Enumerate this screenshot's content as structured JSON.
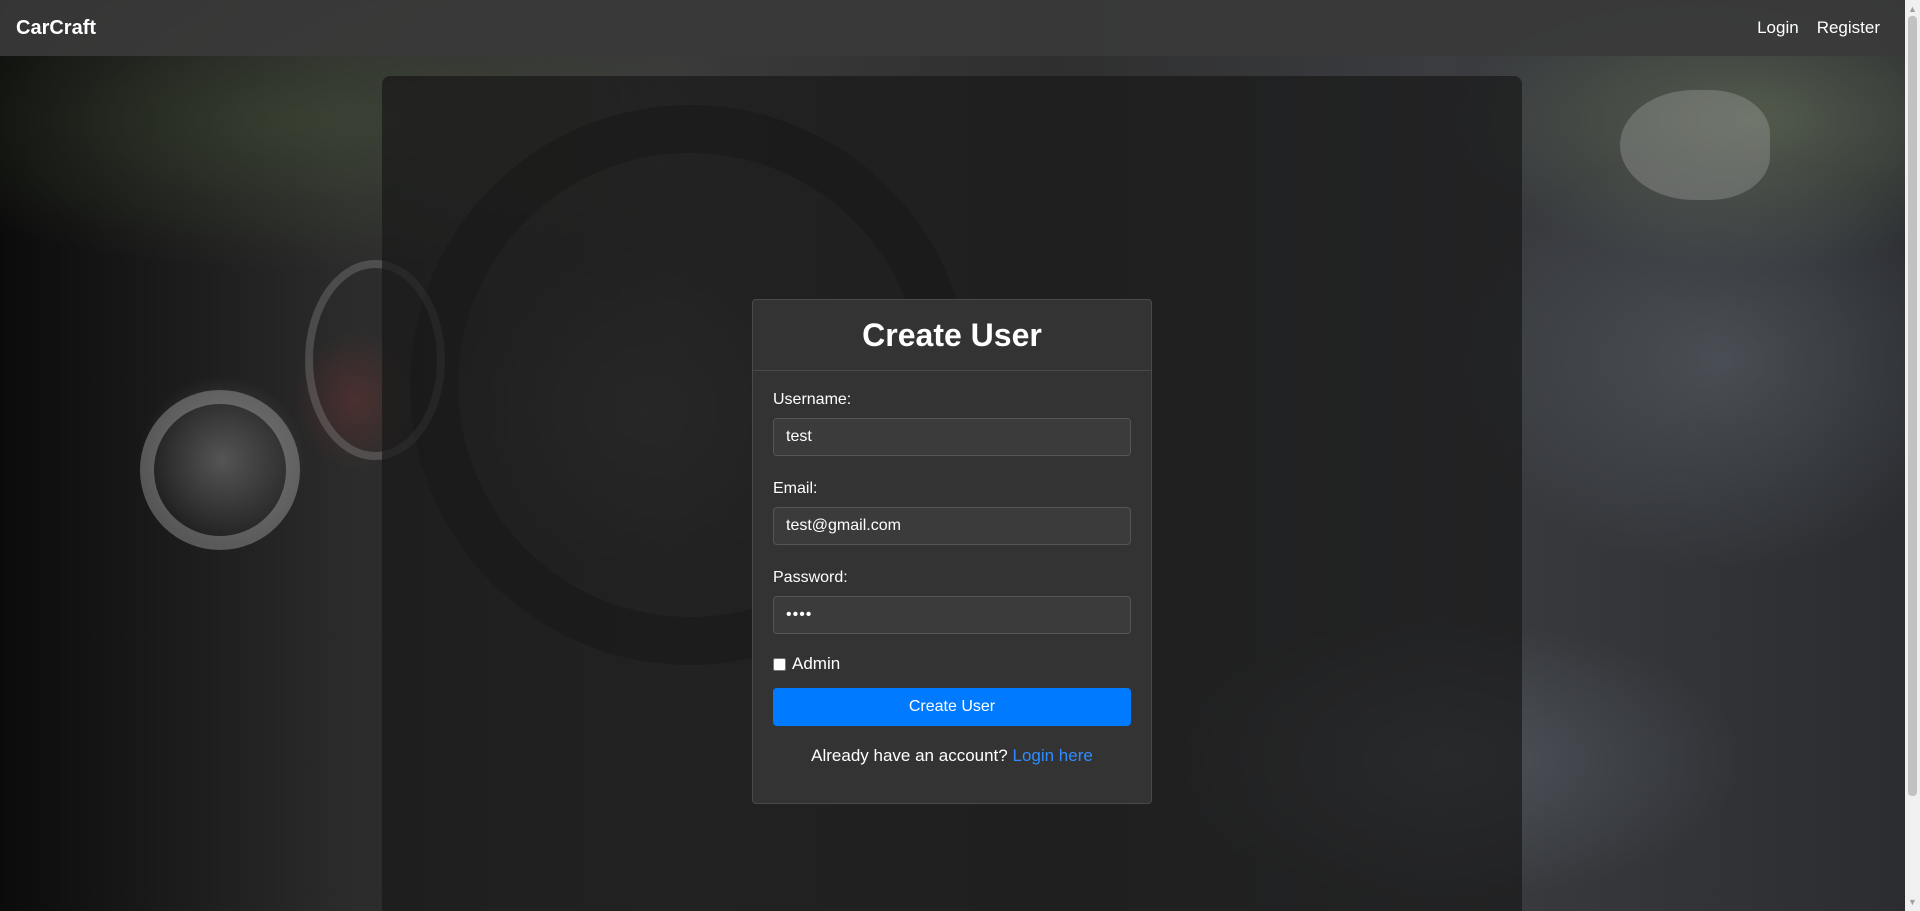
{
  "navbar": {
    "brand": "CarCraft",
    "links": [
      {
        "label": "Login"
      },
      {
        "label": "Register"
      }
    ]
  },
  "form": {
    "title": "Create User",
    "username": {
      "label": "Username:",
      "value": "test"
    },
    "email": {
      "label": "Email:",
      "value": "test@gmail.com"
    },
    "password": {
      "label": "Password:",
      "value": "••••"
    },
    "admin": {
      "label": "Admin",
      "checked": false
    },
    "submit_label": "Create User",
    "login_prompt": "Already have an account?",
    "login_link": "Login here"
  },
  "colors": {
    "primary_button": "#007bff",
    "link": "#2f8cff",
    "card_background": "#333333",
    "navbar_background": "#3a3a3a"
  }
}
